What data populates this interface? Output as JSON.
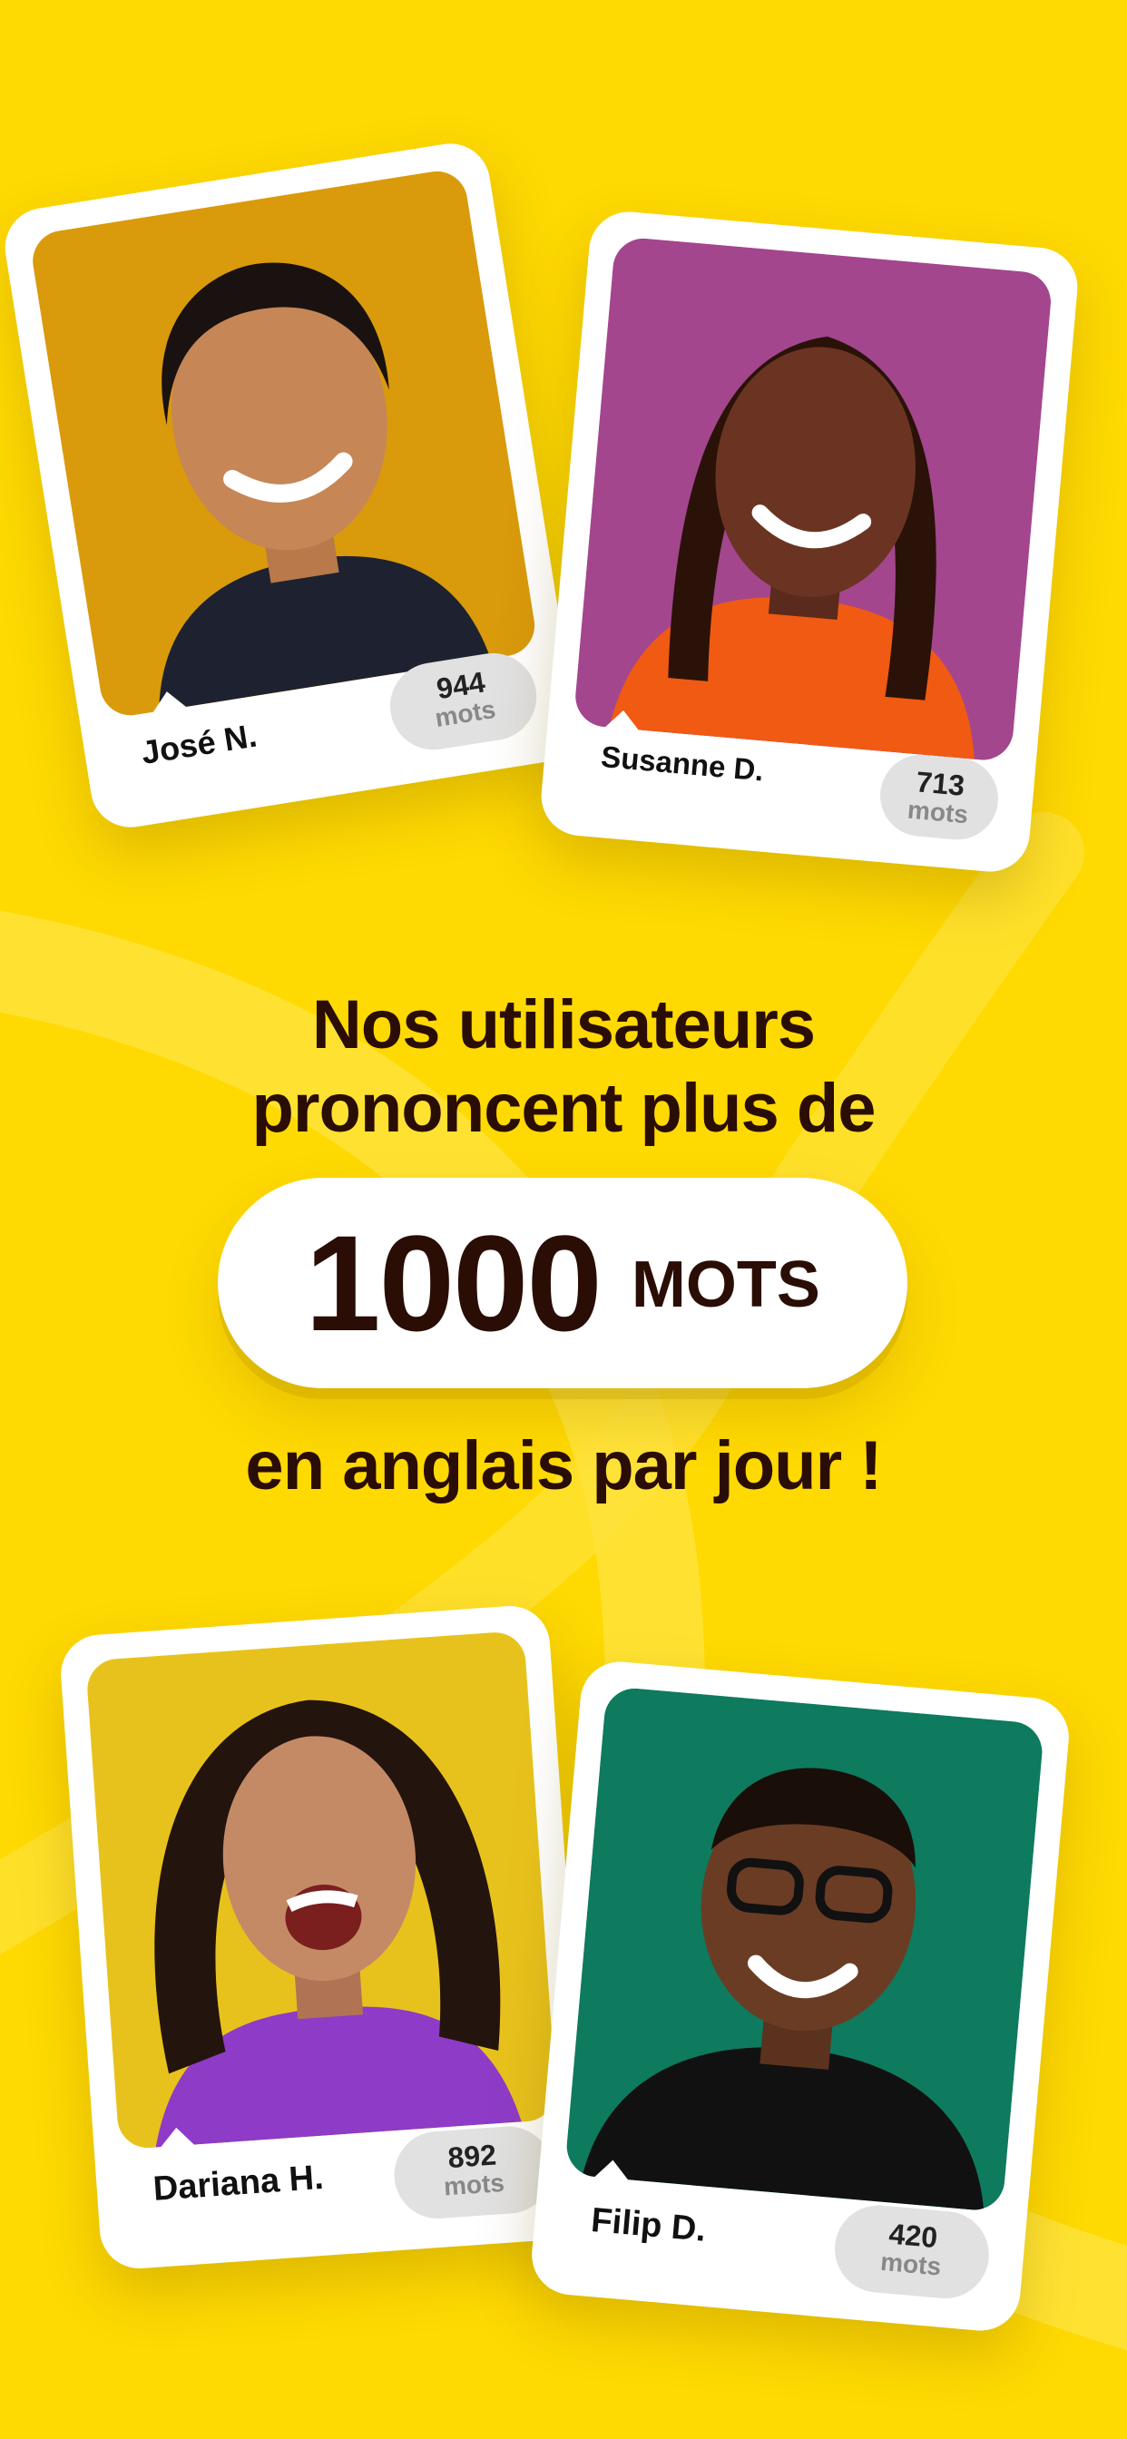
{
  "headline": {
    "line1": "Nos utilisateurs",
    "line2": "prononcent plus de",
    "count": "1000",
    "count_unit": "MOTS",
    "line3": "en anglais par jour !"
  },
  "cards": [
    {
      "name": "José N.",
      "count": "944",
      "unit": "mots",
      "photo_bg": "#D99A0C"
    },
    {
      "name": "Susanne D.",
      "count": "713",
      "unit": "mots",
      "photo_bg": "#A3468E"
    },
    {
      "name": "Dariana H.",
      "count": "892",
      "unit": "mots",
      "photo_bg": "#E8C21C"
    },
    {
      "name": "Filip D.",
      "count": "420",
      "unit": "mots",
      "photo_bg": "#0E7A5E"
    }
  ],
  "colors": {
    "background": "#FFD902",
    "text": "#2A0D05",
    "badge": "#E1E1E1"
  }
}
